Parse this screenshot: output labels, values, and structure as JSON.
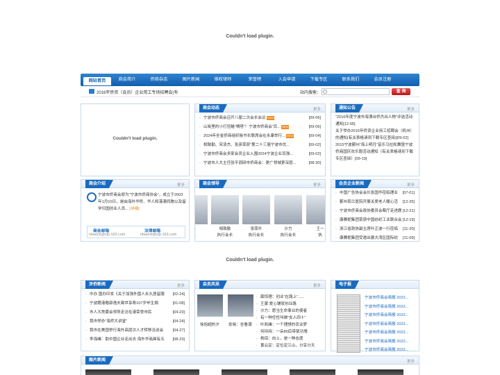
{
  "plugin_messages": {
    "top": "Couldn't load plugin.",
    "box": "Couldn't load plugin.",
    "middle": "Couldn't load plugin."
  },
  "nav": [
    "网站首页",
    "商会简介",
    "侨商杂志",
    "图片新闻",
    "维权律师",
    "荣誉榜",
    "入会申请",
    "下载专区",
    "联系我们",
    "会员注册"
  ],
  "ticker": {
    "text": "2016年侨资（会员）企业用工专场招聘会(有"
  },
  "search": {
    "label": "站内搜索：",
    "button": "查 询"
  },
  "more_label": "更多",
  "shanghui_news": {
    "title": "商会动态",
    "items": [
      {
        "text": "宁波市侨商会召开八届二次会长会议",
        "date": "[09-06]",
        "new": true
      },
      {
        "text": "山晓里的小打狂瞄“嘀嗒”！宁波市侨商会“百...",
        "date": "[09-06]",
        "new": true
      },
      {
        "text": "2024年全省侨商组织秘书长联席会在永康举行...",
        "date": "[09-04]",
        "new": true
      },
      {
        "text": "相致勤、宋凌杰、张彦荣获“第二十三届宁波市优...",
        "date": "[09-02]",
        "new": false
      },
      {
        "text": "宁波市侨商会多家会员企业入围2024宁波企业百强...",
        "date": "[09-02]",
        "new": false
      },
      {
        "text": "宁波市人大主任张平调研市侨商会：更广领域更深层...",
        "date": "[08-30]",
        "new": false
      }
    ]
  },
  "notice": {
    "title": "通知公告",
    "items": [
      "“2016年度宁波市海漂台侨杰出人物”评选活动通知[12-05]",
      "关于举办2015年侨资企业用工招聘会（机州）的通知(有关表格请到下载专区查阅)[09-02]",
      "2015宁波鄞州“海上明月”音乐马拉松舞暨宁波侨商国庆欢乐跑活动通知（有关表格请到下载专区查阅）[09-19]"
    ]
  },
  "intro": {
    "title": "商会介绍",
    "text": "宁波市侨商会原为“宁波市侨商协会”，成立于2003年1月10日，是由海外华侨、华人和港澳同胞以及留学归国创业人员...",
    "detail": "[详细]",
    "mail1_label": "商会邮箱",
    "mail1_addr": "nbaocb@vip.163.com",
    "mail2_label": "法律邮箱",
    "mail2_addr": "nbaocb@vip.163.com"
  },
  "leaders": {
    "title": "商会领导",
    "people": [
      {
        "name": "长",
        "role": "长"
      },
      {
        "name": "相致勤",
        "role": "执行会长"
      },
      {
        "name": "张荣升",
        "role": "执行会长"
      },
      {
        "name": "沙力",
        "role": "执行会长"
      },
      {
        "name": "王一",
        "role": "执"
      }
    ]
  },
  "member_news": {
    "title": "会员企业新闻",
    "items": [
      {
        "text": "中国广告协会会长张国华莅临理业",
        "date": "[07-01]"
      },
      {
        "text": "鄞州现兰医院开展关爱老人暖心活",
        "date": "[12-25]"
      },
      {
        "text": "宁波市侨商会政协委员会蜀厅走进鹿",
        "date": "[12-21]"
      },
      {
        "text": "康赛妮集团荣获中国纺织工业联合会",
        "date": "[12-19]"
      },
      {
        "text": "浙江省政协副主席叶正波一行莅临",
        "date": "[11-20]"
      },
      {
        "text": "康赛妮集团受邀出展大湾区国际纺",
        "date": "[11-09]"
      }
    ]
  },
  "overseas_news": {
    "title": "涉侨新闻",
    "items": [
      {
        "text": "中办 国办印发《关于加强外国人永久居留服",
        "date": "[02-24]"
      },
      {
        "text": "宁波籍港胞邵逸夫离世享寿107岁毕生捐",
        "date": "[01-08]"
      },
      {
        "text": "市人大常委会领导走访在港荣誉市民",
        "date": "[04-23]"
      },
      {
        "text": "我市举办“海侨大讲堂”",
        "date": "[04-24]"
      },
      {
        "text": "我市在美国举行海外高层次人才转移洽谈会",
        "date": "[04-27]"
      },
      {
        "text": "李海峰：助中国企业走出去 海外华商具有五",
        "date": "[08-23]"
      }
    ]
  },
  "member_style": {
    "title": "会员风采",
    "photos": [
      {
        "caption": "徐旭超的夕"
      },
      {
        "caption": "俞晓：坐看潮"
      }
    ],
    "items": [
      "薛惊理：创业“在路上”......",
      "王蒙:爱心铺就创业路",
      "沙力：愿当生命事业的使者",
      "有一种任性叫做“女人四十”",
      "叶凯峰：一个理想的农业梦",
      "何持持：一朵80后带锁功瑰",
      "杨琼：向上，是一种态度",
      "黄云定：定位定江山，分享分天"
    ]
  },
  "epaper": {
    "title": "电子报",
    "items": [
      "宁波市侨商会简报 2022...",
      "宁波市侨商会简报 2022...",
      "宁波市侨商会简报 2022...",
      "宁波市侨商会简报 2022...",
      "宁波市侨商会简报 2022...",
      "宁波市侨商会简报 2022...",
      "宁波市侨商会简报 2022..."
    ]
  },
  "pic_news": {
    "title": "图片新闻"
  }
}
